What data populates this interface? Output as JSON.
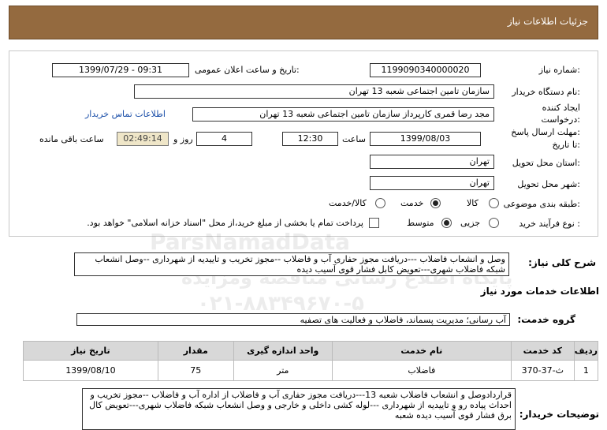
{
  "page": {
    "title": "جزئیات اطلاعات نیاز"
  },
  "fields": {
    "need_number_label": "شماره نیاز:",
    "need_number": "1199090340000020",
    "announce_label": "تاریخ و ساعت اعلان عمومی:",
    "announce_value": "1399/07/29 - 09:31",
    "buyer_org_label": "نام دستگاه خریدار:",
    "buyer_org": "سازمان تامین اجتماعی شعبه 13 تهران",
    "creator_label_1": "ایجاد کننده",
    "creator_label_2": "درخواست:",
    "creator": "مجد رضا قمری کارپرداز سازمان تامین اجتماعی شعبه 13 تهران",
    "contact_link": "اطلاعات تماس خریدار",
    "deadline_label_1": "مهلت ارسال پاسخ:",
    "deadline_label_2": "تا تاریخ:",
    "deadline_date": "1399/08/03",
    "time_label": "ساعت",
    "deadline_time": "12:30",
    "days_value": "4",
    "days_label": "روز و",
    "remaining_time": "02:49:14",
    "remaining_label": "ساعت باقی مانده",
    "province_label": "استان محل تحویل:",
    "province": "تهران",
    "city_label": "شهر محل تحویل:",
    "city": "تهران",
    "category_label": "طبقه بندی موضوعی:",
    "category_options": [
      "کالا",
      "خدمت",
      "کالا/خدمت"
    ],
    "category_selected": "خدمت",
    "process_label": "نوع فرآیند خرید :",
    "process_options": [
      "جزیی",
      "متوسط"
    ],
    "process_selected": "متوسط",
    "treasury_note": "پرداخت تمام یا بخشی از مبلغ خرید،از محل \"اسناد خزانه اسلامی\" خواهد بود."
  },
  "summary": {
    "label": "شرح کلی نیاز:",
    "text": "وصل و انشعاب فاضلاب ---دریافت مجوز حفاری آب و فاضلاب --مجوز تخریب و تاییدیه از شهرداری --وصل انشعاب شبکه فاضلاب شهری---تعویض کابل فشار قوی آسیب دیده"
  },
  "services": {
    "title": "اطلاعات خدمات مورد نیاز",
    "group_label": "گروه خدمت:",
    "group_value": "آب رسانی؛ مدیریت پسماند، فاضلاب و فعالیت های تصفیه",
    "columns": [
      "ردیف",
      "کد خدمت",
      "نام خدمت",
      "واحد اندازه گیری",
      "مقدار",
      "تاریخ نیاز"
    ],
    "rows": [
      [
        "1",
        "ث-37-370",
        "فاضلاب",
        "متر",
        "75",
        "1399/08/10"
      ]
    ]
  },
  "buyer_notes": {
    "label": "توضیحات خریدار:",
    "text": "قراردادوصل و انشعاب فاضلاب شعبه 13---دریافت مجوز حفاری آب و فاضلاب از اداره آب و فاضلاب --مجوز تخریب و احداث پیاده رو و تاییدیه از شهرداری ---لوله کشی داخلی و خارجی و وصل انشعاب شبکه فاضلاب شهری---تعویض کال برق فشار قوی آسیب دیده شعبه"
  },
  "watermark": {
    "brand": "ParsNamadData",
    "line1": "پایگاه اطلاع رسانی مناقصه ومزایده",
    "line2": "۰۲۱-۸۸۳۴۹۶۷۰-۵"
  }
}
